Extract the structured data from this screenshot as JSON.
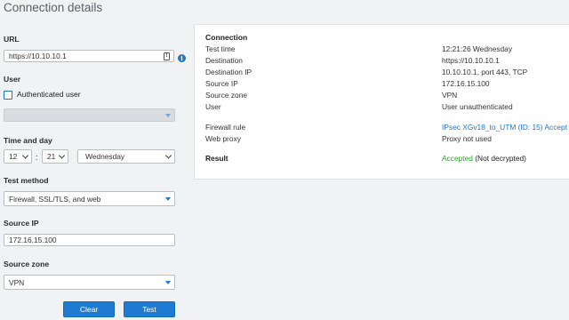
{
  "page_title": "Connection details",
  "form": {
    "url": {
      "label": "URL",
      "value": "https://10.10.10.1"
    },
    "user": {
      "label": "User",
      "authenticated_label": "Authenticated user",
      "authenticated_checked": false,
      "user_select_value": ""
    },
    "time_day": {
      "label": "Time and day",
      "hour": "12",
      "minute": "21",
      "day": "Wednesday"
    },
    "test_method": {
      "label": "Test method",
      "value": "Firewall, SSL/TLS, and web"
    },
    "source_ip": {
      "label": "Source IP",
      "value": "172.16.15.100"
    },
    "source_zone": {
      "label": "Source zone",
      "value": "VPN"
    },
    "buttons": {
      "clear": "Clear",
      "test": "Test"
    }
  },
  "result_panel": {
    "heading": "Connection",
    "rows": [
      {
        "label": "Test time",
        "value": "12:21:26 Wednesday"
      },
      {
        "label": "Destination",
        "value": "https://10.10.10.1"
      },
      {
        "label": "Destination IP",
        "value": "10.10.10.1, port 443, TCP"
      },
      {
        "label": "Source IP",
        "value": "172.16.15.100"
      },
      {
        "label": "Source zone",
        "value": "VPN"
      },
      {
        "label": "User",
        "value": "User unauthenticated"
      }
    ],
    "firewall_rule": {
      "label": "Firewall rule",
      "value": "IPsec XGv18_to_UTM (ID: 15) Accept"
    },
    "web_proxy": {
      "label": "Web proxy",
      "value": "Proxy not used"
    },
    "result": {
      "label": "Result",
      "status": "Accepted",
      "detail": "(Not decrypted)"
    }
  },
  "colors": {
    "accent": "#1e7bd1",
    "link": "#2176c7",
    "accepted": "#2ea02e",
    "background": "#f1f2f4"
  },
  "icons": {
    "url_field_icon": "clipboard-icon",
    "info": "info-icon"
  }
}
